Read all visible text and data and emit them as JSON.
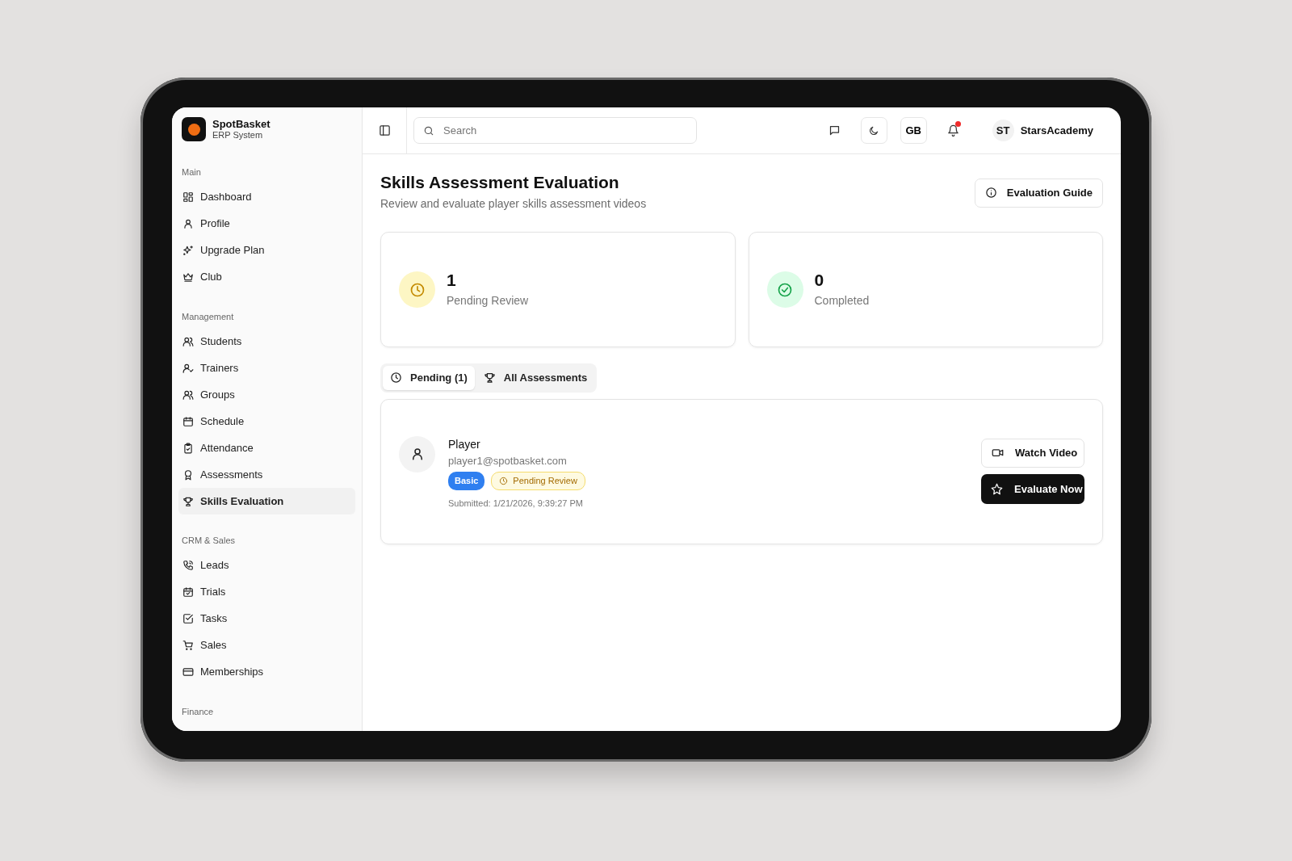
{
  "brand": {
    "name": "SpotBasket",
    "subtitle": "ERP System"
  },
  "sidebar": {
    "sections": [
      {
        "title": "Main",
        "items": [
          {
            "label": "Dashboard",
            "selected": false
          },
          {
            "label": "Profile",
            "selected": false
          },
          {
            "label": "Upgrade Plan",
            "selected": false
          },
          {
            "label": "Club",
            "selected": false
          }
        ]
      },
      {
        "title": "Management",
        "items": [
          {
            "label": "Students",
            "selected": false
          },
          {
            "label": "Trainers",
            "selected": false
          },
          {
            "label": "Groups",
            "selected": false
          },
          {
            "label": "Schedule",
            "selected": false
          },
          {
            "label": "Attendance",
            "selected": false
          },
          {
            "label": "Assessments",
            "selected": false
          },
          {
            "label": "Skills Evaluation",
            "selected": true
          }
        ]
      },
      {
        "title": "CRM & Sales",
        "items": [
          {
            "label": "Leads",
            "selected": false
          },
          {
            "label": "Trials",
            "selected": false
          },
          {
            "label": "Tasks",
            "selected": false
          },
          {
            "label": "Sales",
            "selected": false
          },
          {
            "label": "Memberships",
            "selected": false
          }
        ]
      },
      {
        "title": "Finance"
      }
    ]
  },
  "header": {
    "search": {
      "placeholder": "Search"
    },
    "language": "GB",
    "unread_notifications": true,
    "user": {
      "initials": "ST",
      "name": "StarsAcademy"
    }
  },
  "page": {
    "title": "Skills Assessment Evaluation",
    "subtitle": "Review and evaluate player skills assessment videos",
    "guide_button": "Evaluation Guide"
  },
  "stats": [
    {
      "kind": "pending",
      "value": "1",
      "label": "Pending Review"
    },
    {
      "kind": "completed",
      "value": "0",
      "label": "Completed"
    }
  ],
  "tabs": [
    {
      "kind": "pending",
      "label": "Pending (1)",
      "selected": true
    },
    {
      "kind": "all",
      "label": "All Assessments",
      "selected": false
    }
  ],
  "submissions": [
    {
      "name": "Player",
      "email": "player1@spotbasket.com",
      "plan": "Basic",
      "status": "Pending Review",
      "submitted": "Submitted: 1/21/2026, 9:39:27 PM",
      "watch_button": "Watch Video",
      "evaluate_button": "Evaluate Now"
    }
  ]
}
